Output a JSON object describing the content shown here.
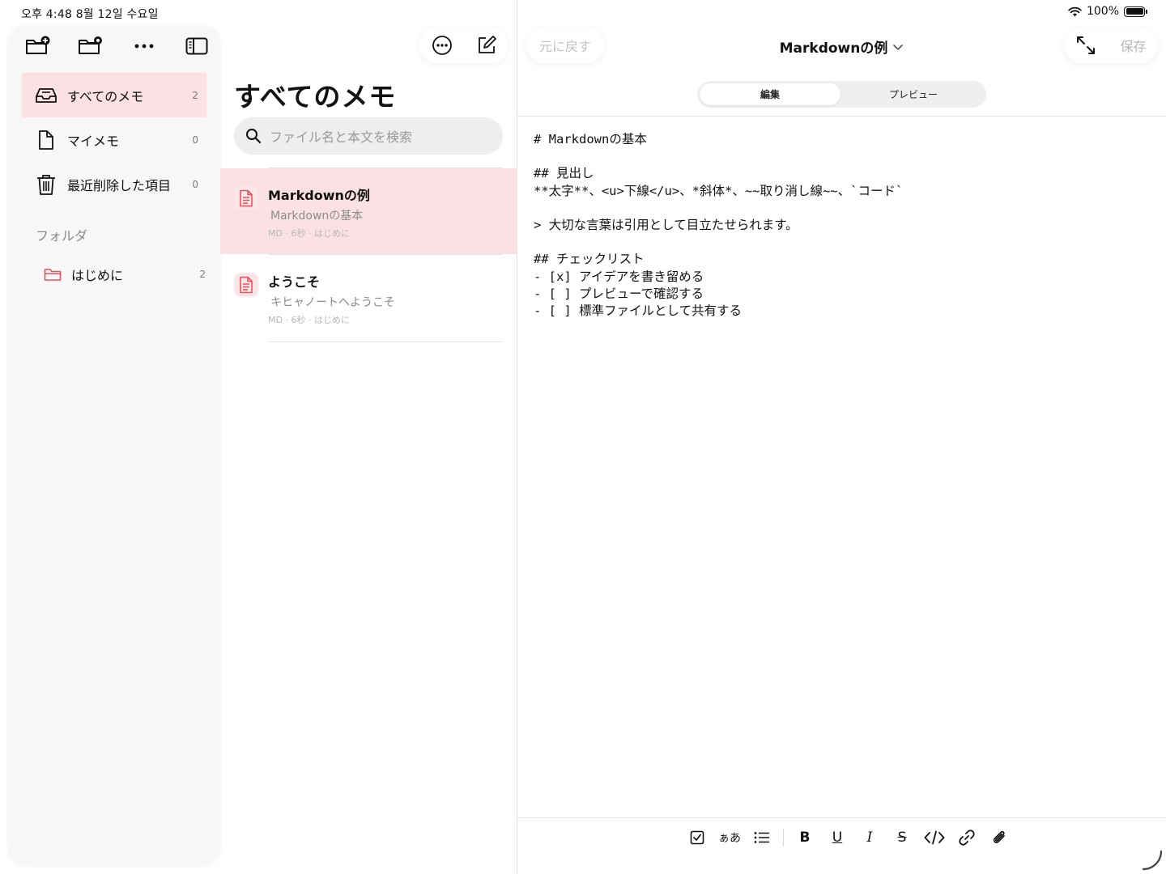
{
  "status": {
    "time_date": "오후 4:48   8월 12일 수요일",
    "battery": "100%",
    "battery_level": 1.0
  },
  "sidebar": {
    "toolbar": [
      "new-folder-icon",
      "folder-settings-icon",
      "more-icon",
      "sidebar-toggle-icon"
    ],
    "items": [
      {
        "label": "すべてのメモ",
        "count": "2",
        "icon": "tray-icon"
      },
      {
        "label": "マイメモ",
        "count": "0",
        "icon": "document-icon"
      },
      {
        "label": "最近削除した項目",
        "count": "0",
        "icon": "trash-icon"
      }
    ],
    "section_label": "フォルダ",
    "folders": [
      {
        "label": "はじめに",
        "count": "2",
        "color": "#e8525f"
      }
    ]
  },
  "list": {
    "title": "すべてのメモ",
    "search_placeholder": "ファイル名と本文を検索",
    "notes": [
      {
        "title": "Markdownの例",
        "preview": "Markdownの基本",
        "meta": "MD · 6秒 · はじめに"
      },
      {
        "title": "ようこそ",
        "preview": "キヒャノートへようこそ",
        "meta": "MD · 6秒 · はじめに"
      }
    ]
  },
  "editor": {
    "undo_label": "元に戻す",
    "doc_title": "Markdownの例",
    "save_label": "保存",
    "tabs": {
      "edit": "編集",
      "preview": "プレビュー"
    },
    "lines": [
      "# Markdownの基本",
      "",
      "## 見出し",
      "**太字**、<u>下線</u>、*斜体*、~~取り消し線~~、`コード`",
      "",
      "> 大切な言葉は引用として目立たせられます。",
      "",
      "## チェックリスト",
      "- [x] アイデアを書き留める",
      "- [ ] プレビューで確認する",
      "- [ ] 標準ファイルとして共有する"
    ],
    "format_bar": {
      "text_style": "ぁあ",
      "bold": "B",
      "underline": "U",
      "italic": "I",
      "strike": "S"
    }
  },
  "colors": {
    "accent": "#e8525f",
    "selection": "#fbe1e3"
  }
}
